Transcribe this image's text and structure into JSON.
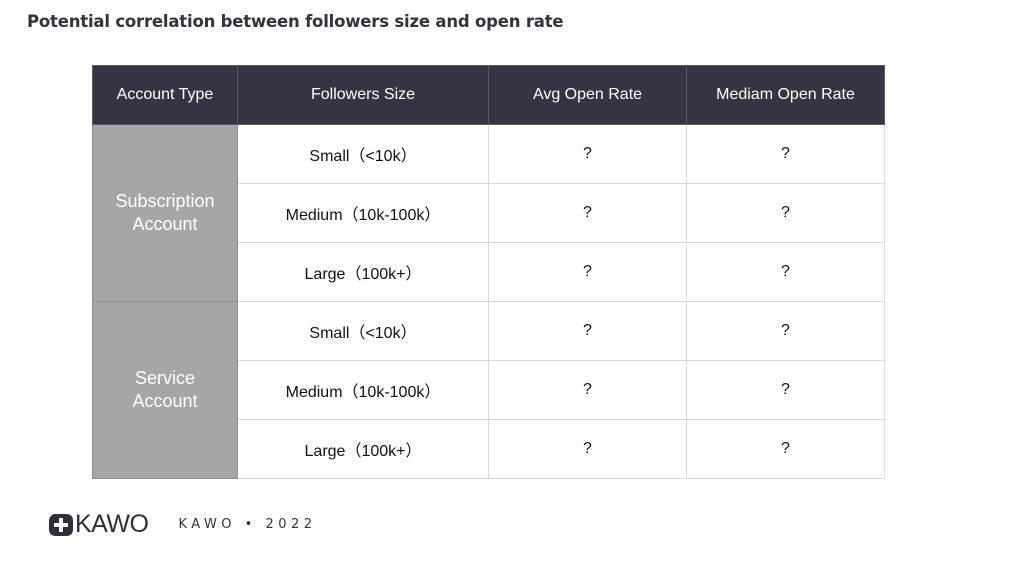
{
  "title": "Potential correlation between followers size and open rate",
  "table": {
    "headers": [
      "Account Type",
      "Followers Size",
      "Avg Open Rate",
      "Mediam Open Rate"
    ],
    "groups": [
      {
        "account_type_line1": "Subscription",
        "account_type_line2": "Account",
        "rows": [
          {
            "size": "Small（<10k）",
            "avg": "?",
            "median": "?"
          },
          {
            "size": "Medium（10k-100k）",
            "avg": "?",
            "median": "?"
          },
          {
            "size": "Large（100k+）",
            "avg": "?",
            "median": "?"
          }
        ]
      },
      {
        "account_type_line1": "Service",
        "account_type_line2": "Account",
        "rows": [
          {
            "size": "Small（<10k）",
            "avg": "?",
            "median": "?"
          },
          {
            "size": "Medium（10k-100k）",
            "avg": "?",
            "median": "?"
          },
          {
            "size": "Large（100k+）",
            "avg": "?",
            "median": "?"
          }
        ]
      }
    ]
  },
  "footer": {
    "logo_text": "KAWO",
    "logo_icon": "kawo-logo-icon",
    "text": "KAWO • 2022"
  },
  "colors": {
    "header_bg": "#343442",
    "account_bg": "#a6a6a6",
    "title": "#33323f"
  }
}
